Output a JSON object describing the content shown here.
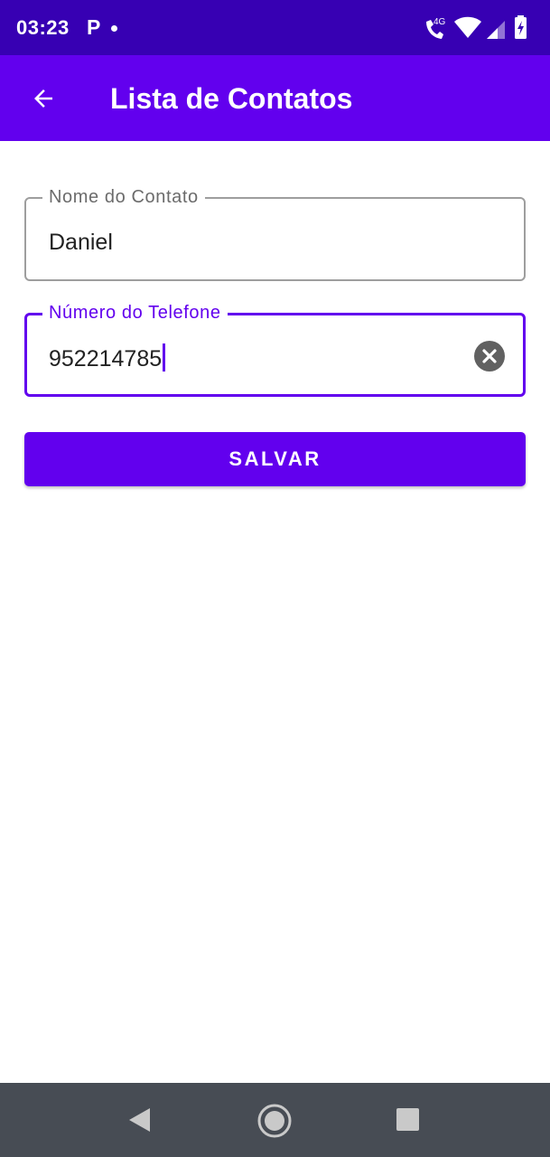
{
  "status_bar": {
    "time": "03:23",
    "notification_icon": "P",
    "network_label": "4G",
    "icons": [
      "parking-app-icon",
      "wifi-call-icon",
      "wifi-icon",
      "cell-signal-icon",
      "battery-charging-icon"
    ]
  },
  "app_bar": {
    "title": "Lista de Contatos",
    "back_icon": "arrow-back-icon"
  },
  "form": {
    "name_field": {
      "label": "Nome do Contato",
      "value": "Daniel"
    },
    "phone_field": {
      "label": "Número do Telefone",
      "value": "952214785",
      "clear_icon": "clear-icon"
    },
    "save_label": "SALVAR"
  },
  "nav_bar": {
    "icons": [
      "nav-back-icon",
      "nav-home-icon",
      "nav-recents-icon"
    ]
  },
  "colors": {
    "status_bar": "#3700b3",
    "primary": "#6200ee",
    "nav_bar": "#474c54",
    "outline": "#9e9e9e"
  }
}
